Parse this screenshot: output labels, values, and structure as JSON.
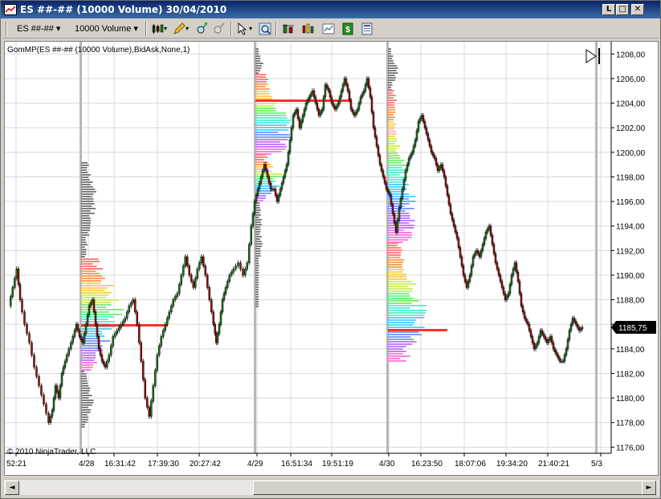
{
  "window": {
    "title": "ES ##-## (10000 Volume)  30/04/2010",
    "controls": [
      "minimize",
      "maximize",
      "close"
    ],
    "control_glyphs": [
      "L",
      "□",
      "✕"
    ]
  },
  "toolbar": {
    "instrument": "ES ##-##",
    "period": "10000 Volume",
    "icons": [
      "bar-type-icon",
      "drawing-pencil-icon",
      "zoom-in-icon",
      "zoom-out-icon",
      "cursor-pointer-icon",
      "crosshair-icon",
      "indicators-icon",
      "strategies-icon",
      "data-box-icon",
      "properties-icon"
    ]
  },
  "chart": {
    "indicator_label": "GomMP(ES ##-## (10000 Volume),BidAsk,None,1)",
    "copyright": "© 2010 NinjaTrader, LLC",
    "current_price": "1185,75",
    "colors": {
      "up": "#1f7a1f",
      "down": "#a01010",
      "grid": "#d8d8d8",
      "price_box": "#000000"
    }
  },
  "chart_data": {
    "type": "candlestick",
    "y_axis": {
      "ylim": [
        1175.5,
        1209
      ],
      "ticks": [
        "1208,00",
        "1206,00",
        "1204,00",
        "1202,00",
        "1200,00",
        "1198,00",
        "1196,00",
        "1194,00",
        "1192,00",
        "1190,00",
        "1188,00",
        "1186,00",
        "1184,00",
        "1182,00",
        "1180,00",
        "1178,00",
        "1176,00"
      ]
    },
    "x_axis": {
      "labels": [
        "52:21",
        "4/28",
        "16:31:42",
        "17:39:30",
        "20:27:42",
        "4/29",
        "16:51:34",
        "19:51:19",
        "4/30",
        "16:23:50",
        "18:07:06",
        "19:34:20",
        "21:40:21",
        "5/3"
      ]
    },
    "session_dividers": [
      "4/28",
      "4/29",
      "4/30",
      "5/3"
    ],
    "price_path": [
      [
        0,
        1187.5
      ],
      [
        5,
        1189
      ],
      [
        10,
        1190.5
      ],
      [
        14,
        1188
      ],
      [
        20,
        1186
      ],
      [
        26,
        1184.5
      ],
      [
        32,
        1182.5
      ],
      [
        38,
        1181
      ],
      [
        44,
        1179.5
      ],
      [
        50,
        1178
      ],
      [
        54,
        1179
      ],
      [
        58,
        1181
      ],
      [
        62,
        1180
      ],
      [
        66,
        1182
      ],
      [
        70,
        1183
      ],
      [
        75,
        1184
      ],
      [
        80,
        1185
      ],
      [
        84,
        1186
      ],
      [
        88,
        1185
      ],
      [
        92,
        1184.5
      ],
      [
        96,
        1186
      ],
      [
        100,
        1187.5
      ],
      [
        104,
        1188
      ],
      [
        108,
        1186
      ],
      [
        112,
        1184
      ],
      [
        116,
        1183
      ],
      [
        120,
        1182.5
      ],
      [
        125,
        1183.5
      ],
      [
        130,
        1185
      ],
      [
        135,
        1185.5
      ],
      [
        140,
        1186
      ],
      [
        145,
        1186.5
      ],
      [
        150,
        1187.5
      ],
      [
        155,
        1188
      ],
      [
        160,
        1186
      ],
      [
        165,
        1183
      ],
      [
        170,
        1180
      ],
      [
        175,
        1178.5
      ],
      [
        180,
        1181
      ],
      [
        185,
        1183.5
      ],
      [
        190,
        1185
      ],
      [
        195,
        1186
      ],
      [
        200,
        1187
      ],
      [
        205,
        1188
      ],
      [
        210,
        1188.5
      ],
      [
        215,
        1190
      ],
      [
        220,
        1191.5
      ],
      [
        225,
        1190
      ],
      [
        230,
        1189
      ],
      [
        235,
        1190.5
      ],
      [
        240,
        1191.5
      ],
      [
        245,
        1190
      ],
      [
        250,
        1188
      ],
      [
        255,
        1186
      ],
      [
        258,
        1184.5
      ],
      [
        262,
        1186
      ],
      [
        266,
        1188
      ],
      [
        270,
        1189
      ],
      [
        275,
        1190
      ],
      [
        280,
        1190.5
      ],
      [
        286,
        1191
      ],
      [
        292,
        1190
      ],
      [
        297,
        1191
      ],
      [
        302,
        1194
      ],
      [
        306,
        1196
      ],
      [
        310,
        1197
      ],
      [
        314,
        1198
      ],
      [
        318,
        1199
      ],
      [
        322,
        1198
      ],
      [
        326,
        1197
      ],
      [
        330,
        1197
      ],
      [
        334,
        1196
      ],
      [
        338,
        1197
      ],
      [
        342,
        1198
      ],
      [
        346,
        1199
      ],
      [
        350,
        1201
      ],
      [
        354,
        1203
      ],
      [
        358,
        1203.5
      ],
      [
        362,
        1202
      ],
      [
        366,
        1203
      ],
      [
        370,
        1204
      ],
      [
        374,
        1204.5
      ],
      [
        378,
        1205
      ],
      [
        382,
        1204
      ],
      [
        386,
        1203
      ],
      [
        390,
        1203.5
      ],
      [
        394,
        1205.5
      ],
      [
        398,
        1205
      ],
      [
        402,
        1204
      ],
      [
        406,
        1203.5
      ],
      [
        410,
        1204
      ],
      [
        414,
        1205
      ],
      [
        418,
        1206
      ],
      [
        422,
        1205
      ],
      [
        426,
        1203.5
      ],
      [
        430,
        1203
      ],
      [
        434,
        1203.5
      ],
      [
        438,
        1204.5
      ],
      [
        442,
        1205
      ],
      [
        446,
        1206
      ],
      [
        450,
        1204.5
      ],
      [
        454,
        1202
      ],
      [
        458,
        1200.5
      ],
      [
        462,
        1199
      ],
      [
        466,
        1198
      ],
      [
        470,
        1197
      ],
      [
        474,
        1196.5
      ],
      [
        478,
        1195
      ],
      [
        482,
        1193.5
      ],
      [
        486,
        1195.5
      ],
      [
        490,
        1197
      ],
      [
        494,
        1198.5
      ],
      [
        498,
        1199.5
      ],
      [
        502,
        1200
      ],
      [
        506,
        1201
      ],
      [
        510,
        1202.5
      ],
      [
        514,
        1203
      ],
      [
        518,
        1202
      ],
      [
        522,
        1201
      ],
      [
        526,
        1200
      ],
      [
        530,
        1199.5
      ],
      [
        534,
        1198.5
      ],
      [
        538,
        1199
      ],
      [
        542,
        1198
      ],
      [
        546,
        1196.5
      ],
      [
        550,
        1195
      ],
      [
        554,
        1194
      ],
      [
        558,
        1193
      ],
      [
        562,
        1191.5
      ],
      [
        566,
        1190
      ],
      [
        570,
        1189
      ],
      [
        574,
        1190
      ],
      [
        578,
        1191.5
      ],
      [
        582,
        1192
      ],
      [
        586,
        1191.5
      ],
      [
        590,
        1192.5
      ],
      [
        594,
        1193.5
      ],
      [
        598,
        1194
      ],
      [
        602,
        1192.5
      ],
      [
        606,
        1191
      ],
      [
        610,
        1190
      ],
      [
        614,
        1189
      ],
      [
        618,
        1188
      ],
      [
        622,
        1188.5
      ],
      [
        626,
        1190
      ],
      [
        630,
        1191
      ],
      [
        634,
        1189.5
      ],
      [
        638,
        1187.5
      ],
      [
        642,
        1186.5
      ],
      [
        646,
        1186
      ],
      [
        650,
        1185
      ],
      [
        654,
        1184
      ],
      [
        658,
        1184.5
      ],
      [
        662,
        1185.5
      ],
      [
        666,
        1185
      ],
      [
        670,
        1184.5
      ],
      [
        674,
        1185
      ],
      [
        678,
        1184
      ],
      [
        682,
        1183.5
      ],
      [
        686,
        1183
      ],
      [
        690,
        1183
      ],
      [
        694,
        1184
      ],
      [
        698,
        1185.5
      ],
      [
        702,
        1186.5
      ],
      [
        706,
        1186
      ],
      [
        710,
        1185.5
      ],
      [
        714,
        1185.75
      ]
    ]
  }
}
